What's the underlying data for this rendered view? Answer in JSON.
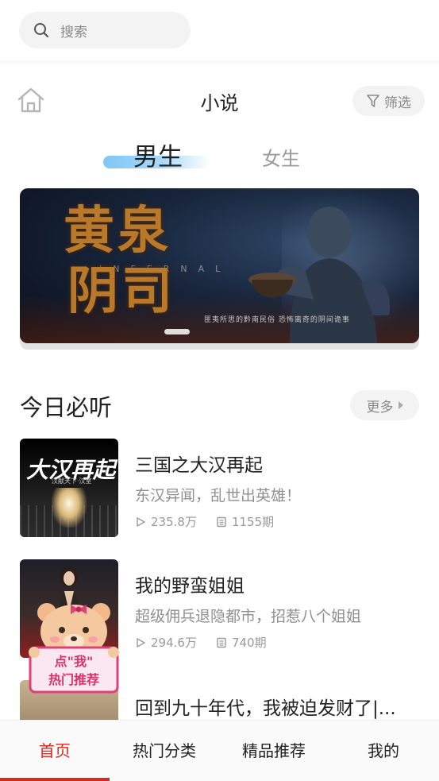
{
  "search": {
    "placeholder": "搜索",
    "icon": "search-icon"
  },
  "header": {
    "title": "小说",
    "filter_label": "筛选",
    "home_icon": "home-icon",
    "filter_icon": "filter-icon"
  },
  "gender_tabs": [
    {
      "label": "男生",
      "active": true
    },
    {
      "label": "女生",
      "active": false
    }
  ],
  "banner": {
    "title_line1": "黄泉",
    "title_line2": "阴司",
    "subtitle_en": "INFERNAL",
    "tagline": "匪夷所思的黔南民俗  恐怖离奇的阴间诡事",
    "slides": 1,
    "active_slide": 1
  },
  "section": {
    "title": "今日必听",
    "more_label": "更多"
  },
  "books": [
    {
      "title": "三国之大汉再起",
      "desc": "东汉异闻，乱世出英雄！",
      "plays": "235.8万",
      "episodes": "1155期",
      "cover_text": "大汉再起",
      "cover_sub": "汉献天下·汉室"
    },
    {
      "title": "我的野蛮姐姐",
      "desc": "超级佣兵退隐都市，招惹八个姐姐",
      "plays": "294.6万",
      "episodes": "740期"
    },
    {
      "title": "回到九十年代，我被迫发财了|..."
    }
  ],
  "promo": {
    "line1": "点\"我\"",
    "line2": "热门推荐"
  },
  "bottom_nav": [
    {
      "label": "首页",
      "active": true
    },
    {
      "label": "热门分类",
      "active": false
    },
    {
      "label": "精品推荐",
      "active": false
    },
    {
      "label": "我的",
      "active": false
    }
  ],
  "colors": {
    "accent": "#d62a1f",
    "tab_highlight": "#7fc6f5",
    "pill_bg": "#f3f3f3"
  }
}
